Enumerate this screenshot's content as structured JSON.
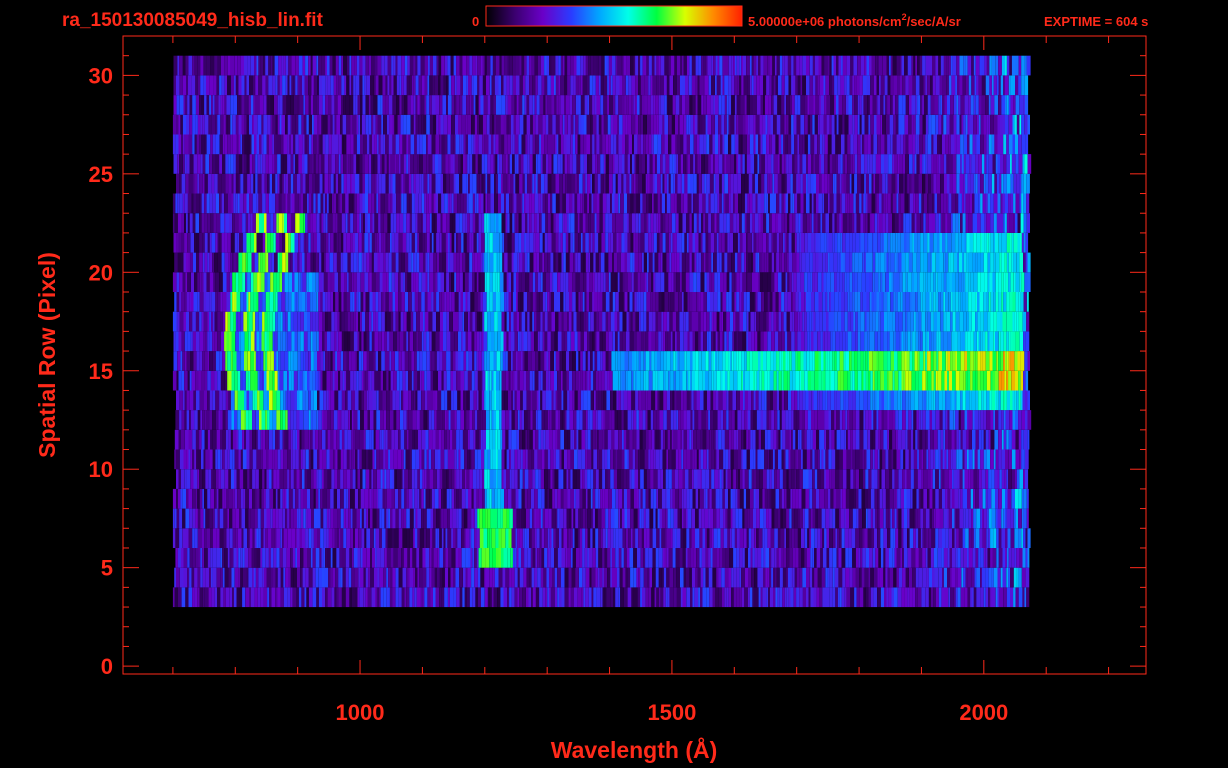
{
  "header": {
    "filename": "ra_150130085049_hisb_lin.fit",
    "colorbar_min": "0",
    "colorbar_max_prefix": "5.00000e+06 photons/cm",
    "colorbar_max_sup": "2",
    "colorbar_max_suffix": "/sec/A/sr",
    "exptime": "EXPTIME = 604 s"
  },
  "colors": {
    "axis": "#ff2a1a",
    "background": "#000000",
    "colormap": [
      "#000000",
      "#3a006e",
      "#6a00c8",
      "#2a3cff",
      "#00a8ff",
      "#00ffe8",
      "#00ff40",
      "#d8ff00",
      "#ff8a00",
      "#ff2000"
    ]
  },
  "chart_data": {
    "type": "heatmap",
    "title": "",
    "xlabel": "Wavelength (Å)",
    "ylabel": "Spatial Row (Pixel)",
    "xlim": [
      620,
      2260
    ],
    "ylim": [
      -0.4,
      32
    ],
    "xticks": [
      1000,
      1500,
      2000
    ],
    "xtick_labels": [
      "1000",
      "1500",
      "2000"
    ],
    "yticks": [
      0,
      5,
      10,
      15,
      20,
      25,
      30
    ],
    "ytick_labels": [
      "0",
      "5",
      "10",
      "15",
      "20",
      "25",
      "30"
    ],
    "colorbar": {
      "min": 0,
      "max": 5000000,
      "units": "photons/cm^2/sec/A/sr"
    },
    "grid": false,
    "features": [
      {
        "feature": "noise background",
        "x": [
          700,
          2070
        ],
        "rows": [
          3,
          30
        ],
        "level": 0.22
      },
      {
        "feature": "continuum band",
        "x": [
          1700,
          2060
        ],
        "rows": [
          13,
          21
        ],
        "level": 0.5
      },
      {
        "feature": "continuum band",
        "x": [
          1400,
          2060
        ],
        "rows": [
          14,
          15
        ],
        "level": 0.72
      },
      {
        "feature": "emission line",
        "x": 1212,
        "rows": [
          5,
          22
        ],
        "level": 0.5
      },
      {
        "feature": "emission blob",
        "x": 1215,
        "rows": [
          5,
          7
        ],
        "level": 0.65
      },
      {
        "feature": "arc lines",
        "x": [
          790,
          905
        ],
        "rows": [
          12,
          22
        ],
        "level": 0.68
      }
    ]
  }
}
